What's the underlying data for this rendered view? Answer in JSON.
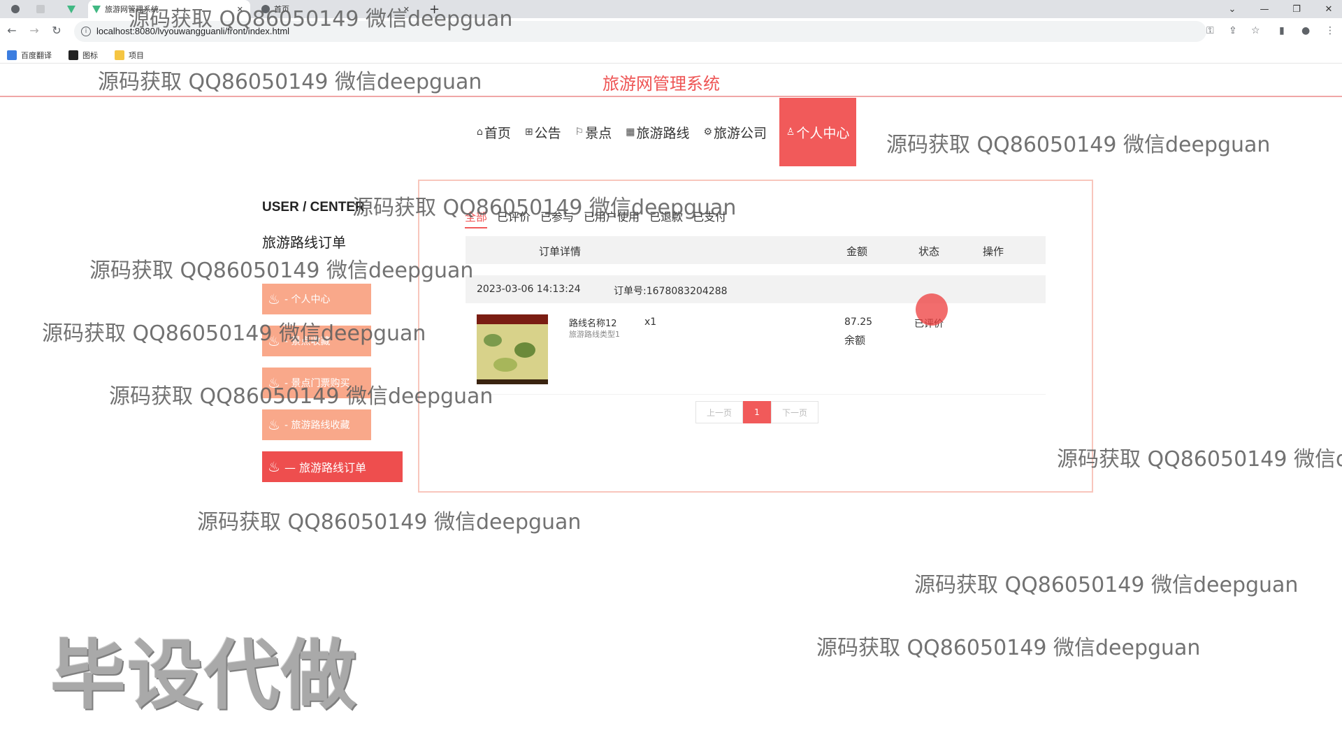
{
  "browser": {
    "tabs": [
      {
        "title": "旅游网管理系统"
      },
      {
        "title": "首页"
      }
    ],
    "url": "localhost:8080/lvyouwangguanli/front/index.html",
    "bookmarks": [
      "百度翻译",
      "图标",
      "项目"
    ]
  },
  "site": {
    "title": "旅游网管理系统",
    "nav": [
      {
        "icon": "home-icon",
        "label": "首页"
      },
      {
        "icon": "notice-icon",
        "label": "公告"
      },
      {
        "icon": "flag-icon",
        "label": "景点"
      },
      {
        "icon": "route-icon",
        "label": "旅游路线"
      },
      {
        "icon": "gear-icon",
        "label": "旅游公司"
      },
      {
        "icon": "user-icon",
        "label": "个人中心"
      }
    ]
  },
  "sidebar": {
    "title": "USER / CENTER",
    "subtitle": "旅游路线订单",
    "items": [
      {
        "label": "- 个人中心"
      },
      {
        "label": "- 景点收藏"
      },
      {
        "label": "- 景点门票购买"
      },
      {
        "label": "- 旅游路线收藏"
      },
      {
        "label": "— 旅游路线订单"
      }
    ]
  },
  "orders": {
    "tabs": [
      "全部",
      "已评价",
      "已参与",
      "已用户使用",
      "已退款",
      "已支付"
    ],
    "columns": {
      "detail": "订单详情",
      "amount": "金额",
      "status": "状态",
      "action": "操作"
    },
    "rows": [
      {
        "time": "2023-03-06 14:13:24",
        "order_no": "订单号:1678083204288",
        "name": "路线名称12",
        "type": "旅游路线类型1",
        "qty": "x1",
        "amount": "87.25",
        "payment": "余额",
        "status": "已评价"
      }
    ],
    "pager": {
      "prev": "上一页",
      "page": "1",
      "next": "下一页"
    }
  },
  "watermarks": {
    "text": "源码获取 QQ86050149 微信deepguan",
    "text_cut": "源码获取 QQ86050149 微信d",
    "big": "毕设代做"
  }
}
